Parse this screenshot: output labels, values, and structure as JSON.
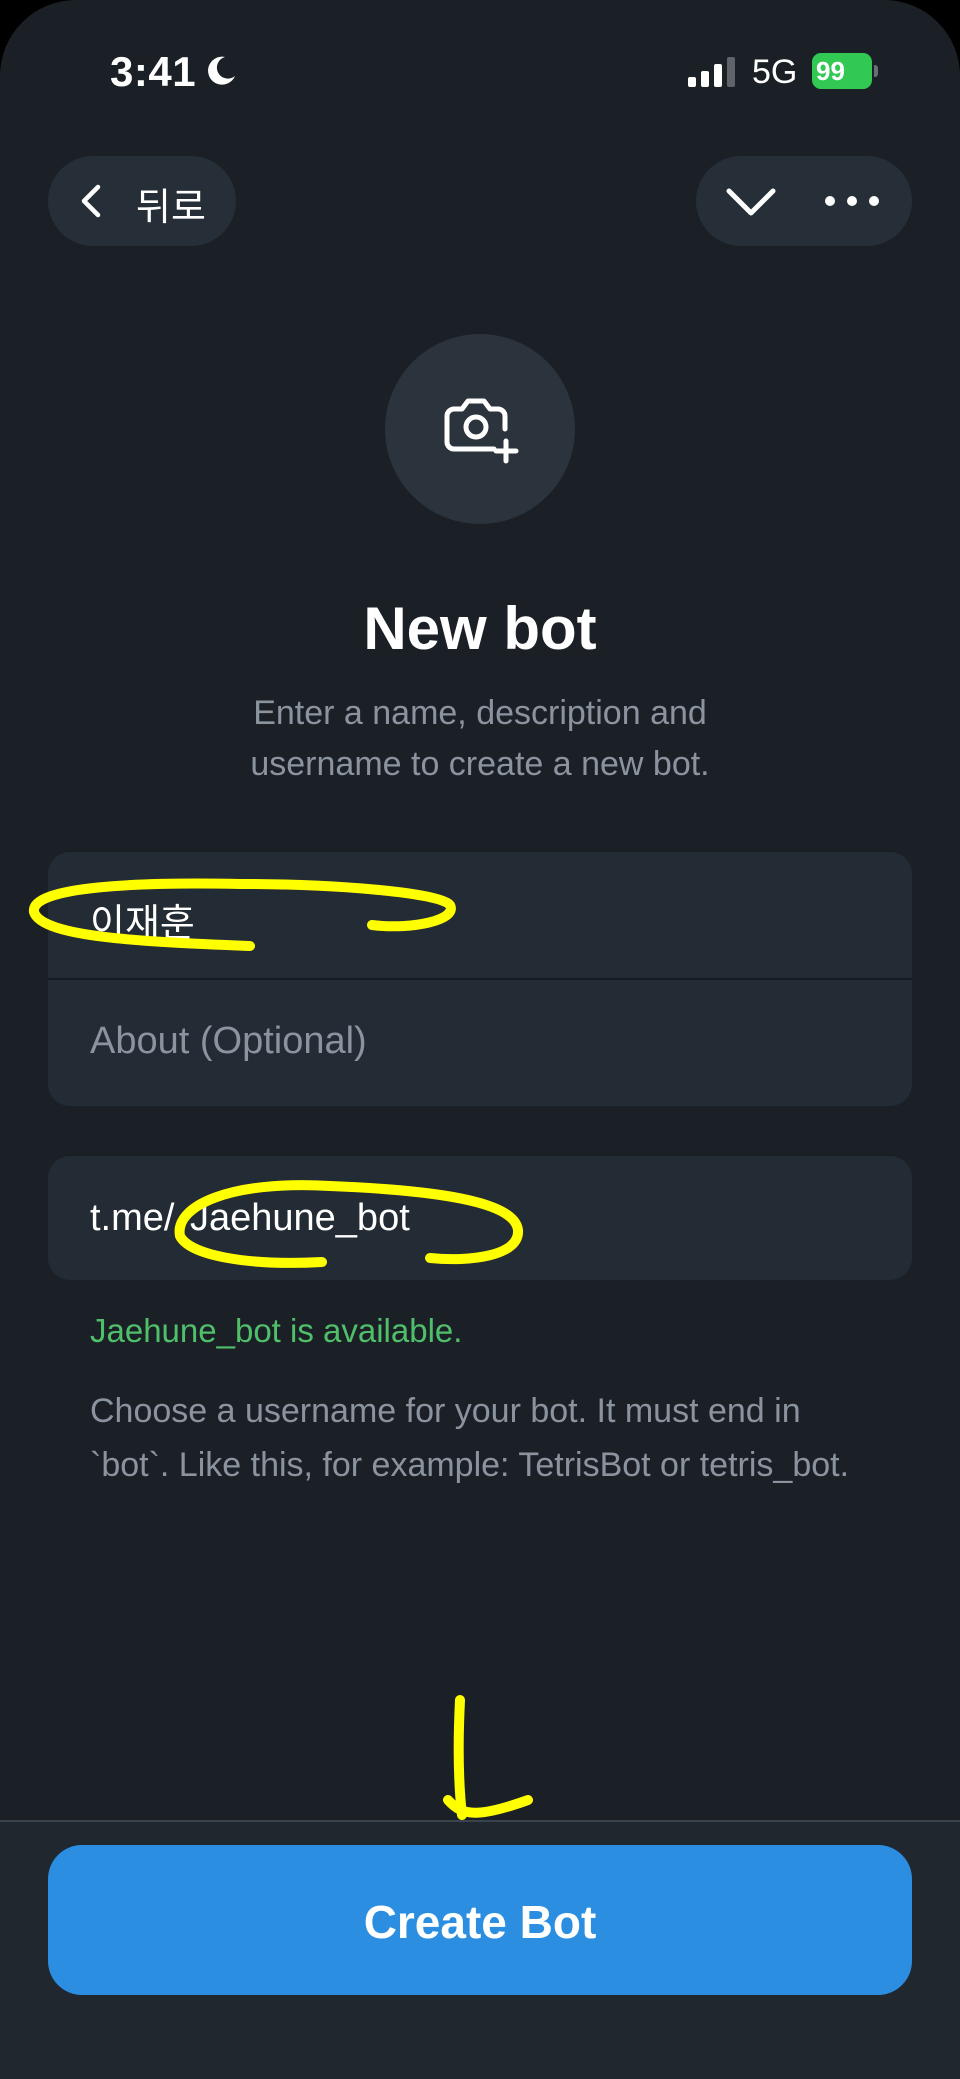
{
  "status_bar": {
    "time": "3:41",
    "network": "5G",
    "battery": "99"
  },
  "nav": {
    "back_label": "뒤로"
  },
  "header": {
    "title": "New bot",
    "subtitle": "Enter a name, description and username to create a new bot."
  },
  "form": {
    "name_value": "이재훈",
    "about_placeholder": "About (Optional)",
    "username_prefix": "t.me/",
    "username_value": "Jaehune_bot"
  },
  "validation": {
    "availability": "Jaehune_bot is available.",
    "help": "Choose a username for your bot. It must end in `bot`. Like this, for example: TetrisBot or tetris_bot."
  },
  "actions": {
    "create_label": "Create Bot"
  },
  "colors": {
    "background": "#1b2027",
    "field": "#232b34",
    "accent": "#2b8ee0",
    "success": "#4fbf6a",
    "annotation": "#ffff00"
  },
  "icons": [
    "moon-icon",
    "signal-icon",
    "battery-icon",
    "chevron-left-icon",
    "chevron-down-icon",
    "more-icon",
    "add-photo-icon"
  ]
}
